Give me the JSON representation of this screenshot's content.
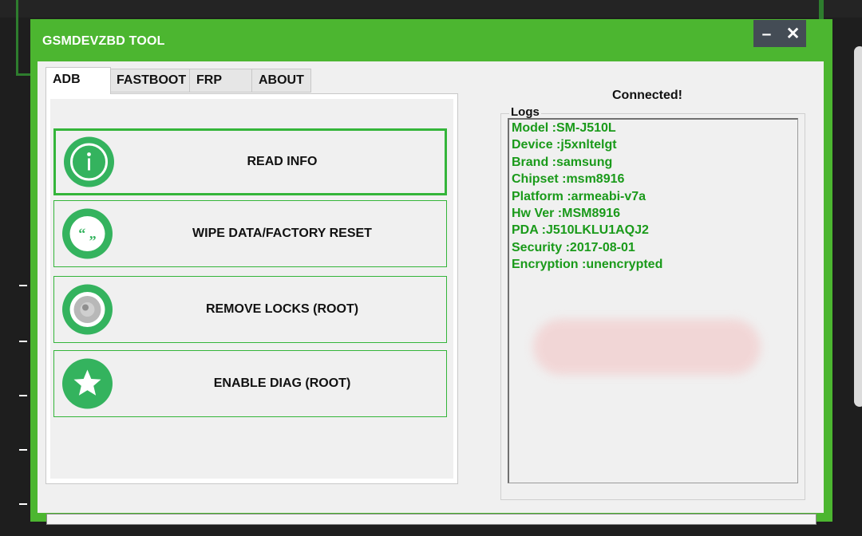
{
  "window": {
    "title": "GSMDEVZBD TOOL",
    "minimize_label": "–",
    "close_label": "✕"
  },
  "tabs": [
    "ADB",
    "FASTBOOT",
    "FRP",
    "ABOUT"
  ],
  "active_tab": "ADB",
  "actions": [
    {
      "label": "READ INFO",
      "icon": "info-icon"
    },
    {
      "label": "WIPE DATA/FACTORY RESET",
      "icon": "quote-icon"
    },
    {
      "label": "REMOVE LOCKS (ROOT)",
      "icon": "camera-lens-icon"
    },
    {
      "label": "ENABLE DIAG (ROOT)",
      "icon": "star-icon"
    }
  ],
  "status": "Connected!",
  "logs": {
    "title": "Logs",
    "lines": [
      "Model  :SM-J510L",
      "Device  :j5xnltelgt",
      "Brand  :samsung",
      "Chipset :msm8916",
      "Platform  :armeabi-v7a",
      "Hw Ver  :MSM8916",
      "PDA    :J510LKLU1AQJ2",
      "Security :2017-08-01",
      "Encryption :unencrypted"
    ]
  },
  "progress": 0,
  "colors": {
    "window_frame": "#4cb630",
    "accent": "#34b35e",
    "log_text": "#1a9a1a",
    "button_border": "#34b53a"
  }
}
